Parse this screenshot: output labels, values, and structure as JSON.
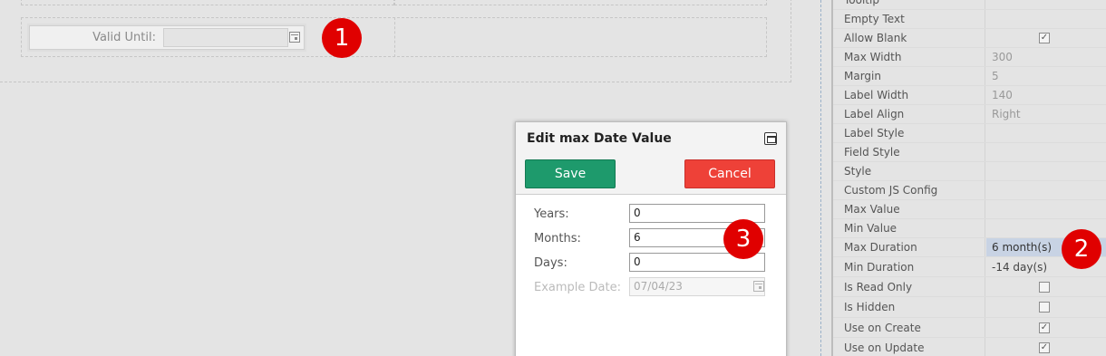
{
  "form": {
    "field_label": "Valid Until:",
    "field_value": ""
  },
  "markers": [
    "1",
    "2",
    "3"
  ],
  "dialog": {
    "title": "Edit max Date Value",
    "save_label": "Save",
    "cancel_label": "Cancel",
    "fields": [
      {
        "label": "Years:",
        "value": "0",
        "disabled": false
      },
      {
        "label": "Months:",
        "value": "6",
        "disabled": false
      },
      {
        "label": "Days:",
        "value": "0",
        "disabled": false
      },
      {
        "label": "Example Date:",
        "value": "07/04/23",
        "disabled": true
      }
    ]
  },
  "properties": [
    {
      "name": "Tooltip",
      "value": ""
    },
    {
      "name": "Empty Text",
      "value": ""
    },
    {
      "name": "Allow Blank",
      "checkbox": true,
      "checked": true
    },
    {
      "name": "Max Width",
      "value": "300"
    },
    {
      "name": "Margin",
      "value": "5"
    },
    {
      "name": "Label Width",
      "value": "140"
    },
    {
      "name": "Label Align",
      "value": "Right"
    },
    {
      "name": "Label Style",
      "value": ""
    },
    {
      "name": "Field Style",
      "value": ""
    },
    {
      "name": "Style",
      "value": ""
    },
    {
      "name": "Custom JS Config",
      "value": ""
    },
    {
      "name": "Max Value",
      "value": ""
    },
    {
      "name": "Min Value",
      "value": ""
    },
    {
      "name": "Max Duration",
      "value": "6 month(s)",
      "selected": true
    },
    {
      "name": "Min Duration",
      "value": "-14 day(s)"
    },
    {
      "name": "Is Read Only",
      "checkbox": true,
      "checked": false
    },
    {
      "name": "Is Hidden",
      "checkbox": true,
      "checked": false
    },
    {
      "name": "Use on Create",
      "checkbox": true,
      "checked": true
    },
    {
      "name": "Use on Update",
      "checkbox": true,
      "checked": true
    }
  ],
  "colors": {
    "save": "#1e9a6c",
    "cancel": "#ee4138",
    "marker": "#e00000",
    "selected_value": "#c8d3e4"
  }
}
